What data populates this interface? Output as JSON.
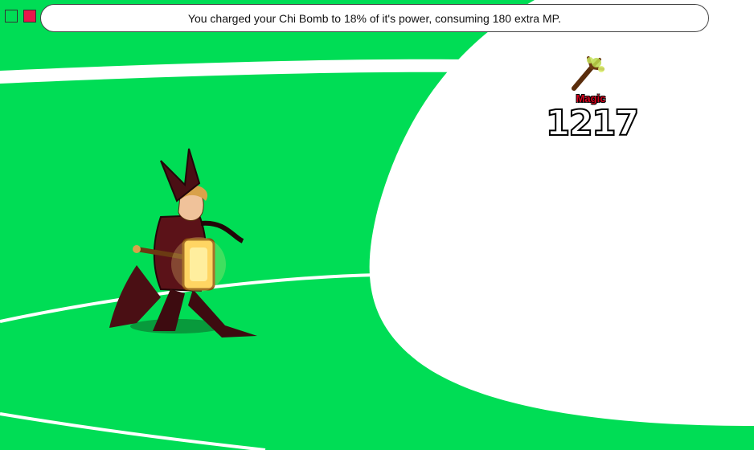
{
  "controls": {
    "squares": [
      {
        "name": "green-square",
        "color": "#00dd55"
      },
      {
        "name": "red-square",
        "color": "#e8164b"
      }
    ]
  },
  "battle": {
    "message": "You charged your Chi Bomb to 18% of it's power, consuming 180 extra MP.",
    "damage": {
      "type_label": "Magic",
      "amount": "1217",
      "icon": "magic-staff-icon"
    },
    "character": "armored-warrior-with-glowing-hammer"
  },
  "colors": {
    "arena_green": "#00dd55",
    "line_white": "#ffffff",
    "magic_label": "#d6001c"
  }
}
